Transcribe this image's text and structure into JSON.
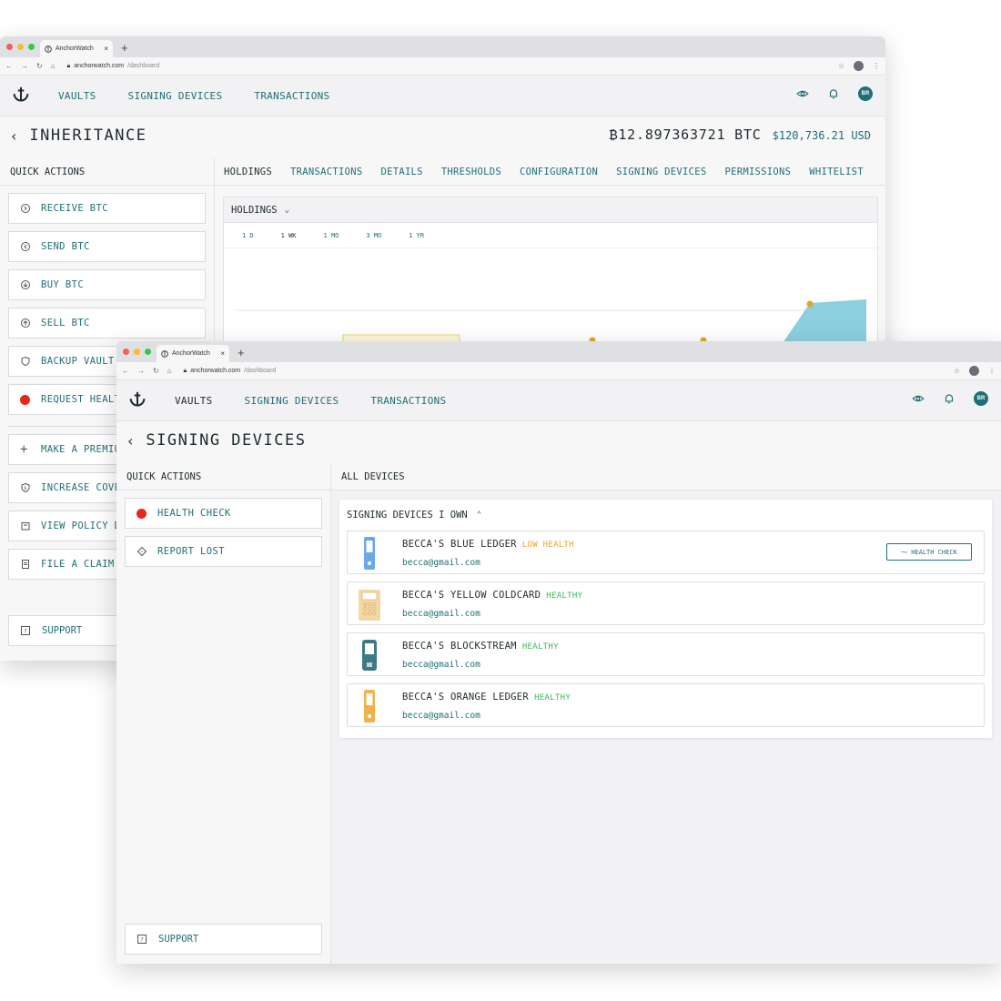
{
  "back_window": {
    "browser": {
      "tab_title": "AnchorWatch",
      "url_domain": "anchorwatch.com",
      "url_path": "/dashboard"
    },
    "nav": {
      "links": [
        "VAULTS",
        "SIGNING DEVICES",
        "TRANSACTIONS"
      ],
      "avatar": "BR"
    },
    "title": "INHERITANCE",
    "btc_balance": "₿12.897363721 BTC",
    "usd_balance": "$120,736.21 USD",
    "quick_actions": {
      "heading": "QUICK ACTIONS",
      "items": [
        "RECEIVE BTC",
        "SEND BTC",
        "BUY BTC",
        "SELL BTC",
        "BACKUP VAULT",
        "REQUEST HEALTH CHECK"
      ],
      "items2": [
        "MAKE A PREMIUM PAYMENT",
        "INCREASE COVERAGE",
        "VIEW POLICY DETAILS",
        "FILE A CLAIM"
      ],
      "support": "SUPPORT"
    },
    "tabs": [
      "HOLDINGS",
      "TRANSACTIONS",
      "DETAILS",
      "THRESHOLDS",
      "CONFIGURATION",
      "SIGNING DEVICES",
      "PERMISSIONS",
      "WHITELIST"
    ],
    "holdings": {
      "heading": "HOLDINGS",
      "ranges": [
        "1 D",
        "1 WK",
        "1 MO",
        "3 MO",
        "1 YR"
      ],
      "active_range": "1 WK"
    }
  },
  "front_window": {
    "browser": {
      "tab_title": "AnchorWatch",
      "url_domain": "anchorwatch.com",
      "url_path": "/dashboard"
    },
    "nav": {
      "links": [
        "VAULTS",
        "SIGNING DEVICES",
        "TRANSACTIONS"
      ],
      "avatar": "BR"
    },
    "title": "SIGNING DEVICES",
    "quick_actions": {
      "heading": "QUICK ACTIONS",
      "health_check": "HEALTH CHECK",
      "report_lost": "REPORT LOST",
      "support": "SUPPORT"
    },
    "all_devices_heading": "ALL DEVICES",
    "section_heading": "SIGNING DEVICES I OWN",
    "devices": [
      {
        "name": "BECCA'S BLUE LEDGER",
        "status": "LOW HEALTH",
        "email": "becca@gmail.com",
        "status_color": "#f0a02a",
        "device_color": "#6aa8e8"
      },
      {
        "name": "BECCA'S YELLOW COLDCARD",
        "status": "HEALTHY",
        "email": "becca@gmail.com",
        "status_color": "#3dba5a",
        "device_color": "#f3d8a6"
      },
      {
        "name": "BECCA'S BLOCKSTREAM",
        "status": "HEALTHY",
        "email": "becca@gmail.com",
        "status_color": "#3dba5a",
        "device_color": "#3c7a86"
      },
      {
        "name": "BECCA'S ORANGE LEDGER",
        "status": "HEALTHY",
        "email": "becca@gmail.com",
        "status_color": "#3dba5a",
        "device_color": "#f4b04a"
      }
    ],
    "health_check_button": "HEALTH CHECK"
  },
  "colors": {
    "accent": "#1f6f77",
    "alert_red": "#e8271b",
    "warning": "#f0a02a",
    "healthy": "#3dba5a",
    "chart_fill": "#8ccfdf",
    "chart_point": "#e0a81e"
  }
}
